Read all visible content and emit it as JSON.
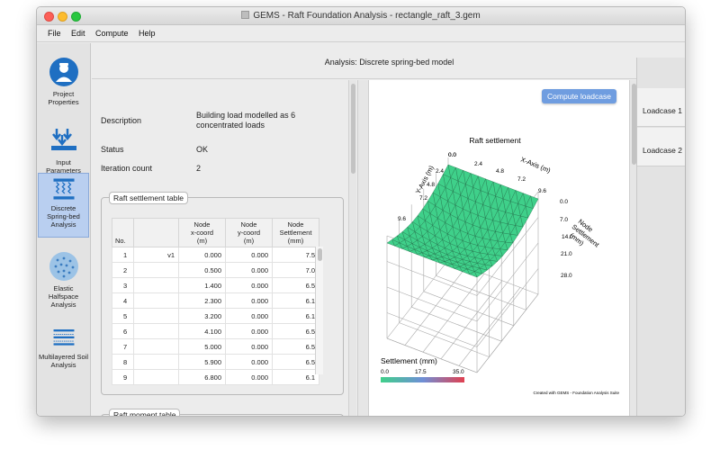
{
  "window": {
    "title": "GEMS - Raft Foundation Analysis - rectangle_raft_3.gem"
  },
  "menu": [
    "File",
    "Edit",
    "Compute",
    "Help"
  ],
  "sidebar": {
    "items": [
      {
        "label1": "Project",
        "label2": "Properties",
        "icon": "user-icon",
        "active": false
      },
      {
        "label1": "Input",
        "label2": "Parameters",
        "icon": "input-arrows-icon",
        "active": false
      },
      {
        "label1": "Discrete",
        "label2": "Spring-bed",
        "label3": "Analysis",
        "icon": "springs-icon",
        "active": true
      },
      {
        "label1": "Elastic",
        "label2": "Halfspace",
        "label3": "Analysis",
        "icon": "halfspace-icon",
        "active": false
      },
      {
        "label1": "Multilayered Soil",
        "label2": "Analysis",
        "icon": "layers-icon",
        "active": false
      }
    ]
  },
  "header": {
    "title": "Analysis: Discrete spring-bed model"
  },
  "info": {
    "description_label": "Description",
    "description_line1": "Building load modelled as 6",
    "description_line2": "concentrated loads",
    "status_label": "Status",
    "status_value": "OK",
    "iteration_label": "Iteration count",
    "iteration_value": "2"
  },
  "settlement_table": {
    "title": "Raft settlement table",
    "headers": {
      "no": "No.",
      "x1": "Node",
      "x2": "x-coord",
      "x3": "(m)",
      "y1": "Node",
      "y2": "y-coord",
      "y3": "(m)",
      "s1": "Node",
      "s2": "Settlement",
      "s3": "(mm)"
    },
    "rows": [
      {
        "no": "1",
        "name": "v1",
        "x": "0.000",
        "y": "0.000",
        "s": "7.5"
      },
      {
        "no": "2",
        "name": "",
        "x": "0.500",
        "y": "0.000",
        "s": "7.0"
      },
      {
        "no": "3",
        "name": "",
        "x": "1.400",
        "y": "0.000",
        "s": "6.5"
      },
      {
        "no": "4",
        "name": "",
        "x": "2.300",
        "y": "0.000",
        "s": "6.1"
      },
      {
        "no": "5",
        "name": "",
        "x": "3.200",
        "y": "0.000",
        "s": "6.1"
      },
      {
        "no": "6",
        "name": "",
        "x": "4.100",
        "y": "0.000",
        "s": "6.5"
      },
      {
        "no": "7",
        "name": "",
        "x": "5.000",
        "y": "0.000",
        "s": "6.5"
      },
      {
        "no": "8",
        "name": "",
        "x": "5.900",
        "y": "0.000",
        "s": "6.5"
      },
      {
        "no": "9",
        "name": "",
        "x": "6.800",
        "y": "0.000",
        "s": "6.1"
      }
    ]
  },
  "moment_table": {
    "title": "Raft moment table"
  },
  "plot": {
    "compute_button": "Compute loadcase",
    "title": "Raft settlement",
    "x_axis_label": "X-Axis (m)",
    "y_axis_label": "Y-Axis (m)",
    "z_axis_label1": "Node",
    "z_axis_label2": "Settlement",
    "z_axis_label3": "(mm)",
    "x_ticks": [
      "0.0",
      "2.4",
      "4.8",
      "7.2",
      "9.6"
    ],
    "y_ticks": [
      "0.0",
      "2.4",
      "4.8",
      "7.2",
      "9.6"
    ],
    "z_ticks": [
      "0.0",
      "7.0",
      "14.0",
      "21.0",
      "28.0"
    ],
    "colorbar_title": "Settlement (mm)",
    "colorbar_ticks": [
      "0.0",
      "17.5",
      "35.0"
    ],
    "credit": "Created with GEMS - Foundation Analysis Suite",
    "colors": {
      "surface": "#3fd08a",
      "mesh": "#1f6b46",
      "colorbar_start": "#3fd08a",
      "colorbar_mid": "#6f8fd6",
      "colorbar_end": "#e04050"
    }
  },
  "loadcases": [
    "Loadcase 1",
    "Loadcase 2"
  ]
}
